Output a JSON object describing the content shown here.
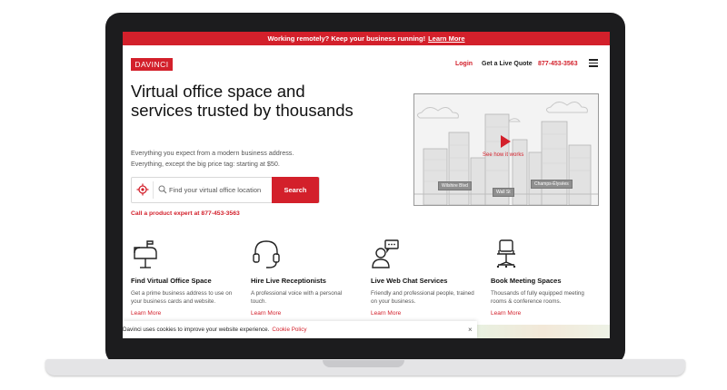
{
  "promo": {
    "text": "Working remotely? Keep your business running!",
    "link": "Learn More"
  },
  "header": {
    "logo": "DAVINCI",
    "login": "Login",
    "quote": "Get a Live Quote",
    "phone": "877-453-3563"
  },
  "hero": {
    "title": "Virtual office space and services trusted by thousands",
    "subtitle_line1": "Everything you expect from a modern business address.",
    "subtitle_line2": "Everything, except the big price tag: starting at $50.",
    "search_placeholder": "Find your virtual office location",
    "search_button": "Search",
    "call_text": "Call a product expert at 877-453-3563"
  },
  "video": {
    "label": "See how it works",
    "signs": [
      "Wilshire Blvd",
      "Wall St",
      "Champs-Élysées"
    ]
  },
  "features": [
    {
      "icon": "mailbox-icon",
      "title": "Find Virtual Office Space",
      "desc": "Get a prime business address to use on your business cards and website.",
      "link": "Learn More"
    },
    {
      "icon": "headset-icon",
      "title": "Hire Live Receptionists",
      "desc": "A professional voice with a personal touch.",
      "link": "Learn More"
    },
    {
      "icon": "chat-agent-icon",
      "title": "Live Web Chat Services",
      "desc": "Friendly and professional people, trained on your business.",
      "link": "Learn More"
    },
    {
      "icon": "office-chair-icon",
      "title": "Book Meeting Spaces",
      "desc": "Thousands of fully equipped meeting rooms & conference rooms.",
      "link": "Learn More"
    }
  ],
  "cookie": {
    "text": "Davinci uses cookies to improve your website experience.",
    "link": "Cookie Policy",
    "close": "×"
  },
  "colors": {
    "brand": "#d3202b",
    "text": "#111111",
    "muted": "#555555"
  }
}
